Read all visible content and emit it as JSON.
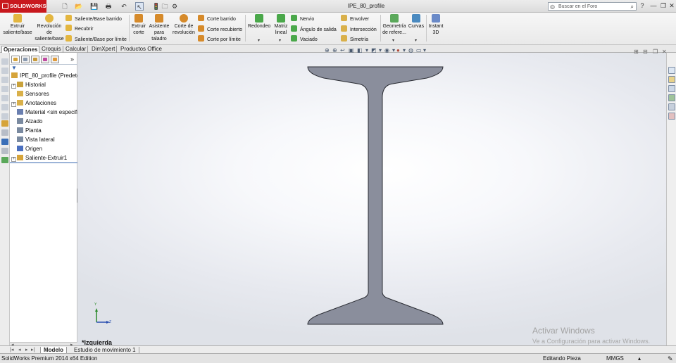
{
  "app": {
    "name": "SOLIDWORKS",
    "document_title": "IPE_80_profile"
  },
  "quick_access": {
    "new": "🗋",
    "open": "📂",
    "save": "💾",
    "print": "🖶",
    "undo": "↶",
    "select": "↖",
    "rebuild": "🚦",
    "file_props": "🗀",
    "options": "⚙"
  },
  "search": {
    "placeholder": "Buscar en el Foro"
  },
  "window_controls": {
    "help": "?",
    "minimize": "—",
    "restore": "❐",
    "close": "✕"
  },
  "ribbon": {
    "extrude_boss": "Extruir saliente/base",
    "revolve_boss": "Revolución de saliente/base",
    "swept_boss": "Saliente/Base barrido",
    "loft_boss": "Recubrir",
    "boundary_boss": "Saliente/Base por límite",
    "extrude_cut": "Extruir corte",
    "hole_wizard": "Asistente para taladro",
    "revolve_cut": "Corte de revolución",
    "swept_cut": "Corte barrido",
    "loft_cut": "Corte recubierto",
    "boundary_cut": "Corte por límite",
    "fillet": "Redondeo",
    "linear_pattern": "Matriz lineal",
    "rib": "Nervio",
    "draft": "Ángulo de salida",
    "shell": "Vaciado",
    "wrap": "Envolver",
    "intersect": "Intersección",
    "mirror": "Simetría",
    "ref_geometry": "Geometría de refere...",
    "curves": "Curvas",
    "instant3d": "Instant 3D"
  },
  "command_tabs": [
    "Operaciones",
    "Croquis",
    "Calcular",
    "DimXpert",
    "Productos Office"
  ],
  "feature_tree": {
    "filter_icon": "funnel-icon",
    "part_name": "IPE_80_profile  (Predetermin",
    "expand_symbol": "+",
    "items": [
      {
        "label": "Historial",
        "has_children": true,
        "color": "#c9a23c"
      },
      {
        "label": "Sensores",
        "has_children": false,
        "color": "#d9b04a"
      },
      {
        "label": "Anotaciones",
        "has_children": true,
        "color": "#d9b04a"
      },
      {
        "label": "Material <sin especificar>",
        "has_children": false,
        "color": "#6a7fb0"
      },
      {
        "label": "Alzado",
        "has_children": false,
        "color": "#7a8aa0"
      },
      {
        "label": "Planta",
        "has_children": false,
        "color": "#7a8aa0"
      },
      {
        "label": "Vista lateral",
        "has_children": false,
        "color": "#7a8aa0"
      },
      {
        "label": "Origen",
        "has_children": false,
        "color": "#4a6fbf"
      },
      {
        "label": "Saliente-Extruir1",
        "has_children": true,
        "color": "#d6a43a"
      }
    ]
  },
  "panel_toggle": "»",
  "graphics": {
    "view_label": "*Izquierda",
    "axis_x": "Z",
    "axis_y": "Y",
    "watermark_title": "Activar Windows",
    "watermark_sub": "Ve a Configuración para activar Windows.",
    "part_fill": "#8a8e9c"
  },
  "model_tabs": [
    "Modelo",
    "Estudio de movimiento 1"
  ],
  "status_bar": {
    "product": "SolidWorks Premium 2014 x64 Edition",
    "mode": "Editando Pieza",
    "units": "MMGS",
    "units_arrow": "▴"
  },
  "colors": {
    "brand_red": "#c8181e",
    "accent_blue": "#3666b0"
  }
}
